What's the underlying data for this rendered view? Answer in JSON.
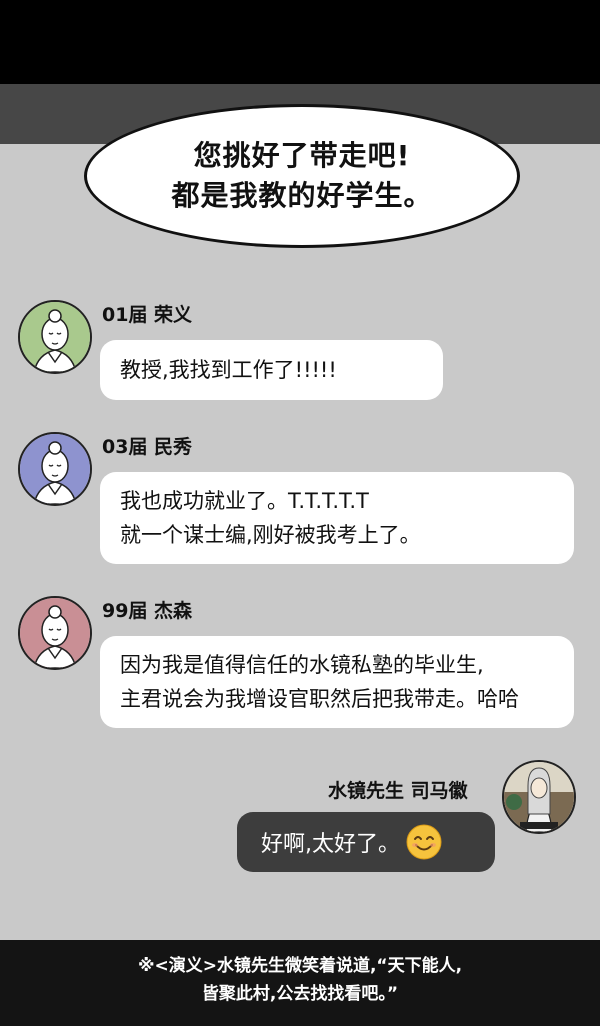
{
  "speech_bubble": {
    "line1": "您挑好了带走吧!",
    "line2": "都是我教的好学生。"
  },
  "messages": [
    {
      "sender": "01届 荣义",
      "avatar_color": "#a9c98d",
      "lines": [
        "教授,我找到工作了!!!!!"
      ]
    },
    {
      "sender": "03届 民秀",
      "avatar_color": "#8e93cf",
      "lines": [
        "我也成功就业了。T.T.T.T.T",
        "就一个谋士编,刚好被我考上了。"
      ]
    },
    {
      "sender": "99届 杰森",
      "avatar_color": "#c98f95",
      "lines": [
        "因为我是值得信任的水镜私塾的毕业生,",
        "主君说会为我增设官职然后把我带走。哈哈"
      ]
    }
  ],
  "reply": {
    "sender": "水镜先生 司马徽",
    "text": "好啊,太好了。",
    "emoji": "smiling-face"
  },
  "caption": {
    "line1": "※<演义>水镜先生微笑着说道,“天下能人,",
    "line2": "皆聚此村,公去找找看吧。”"
  },
  "colors": {
    "panel_bg": "#c9c9c9",
    "reply_bubble": "#3d3d3d",
    "caption_bg": "#141414"
  }
}
